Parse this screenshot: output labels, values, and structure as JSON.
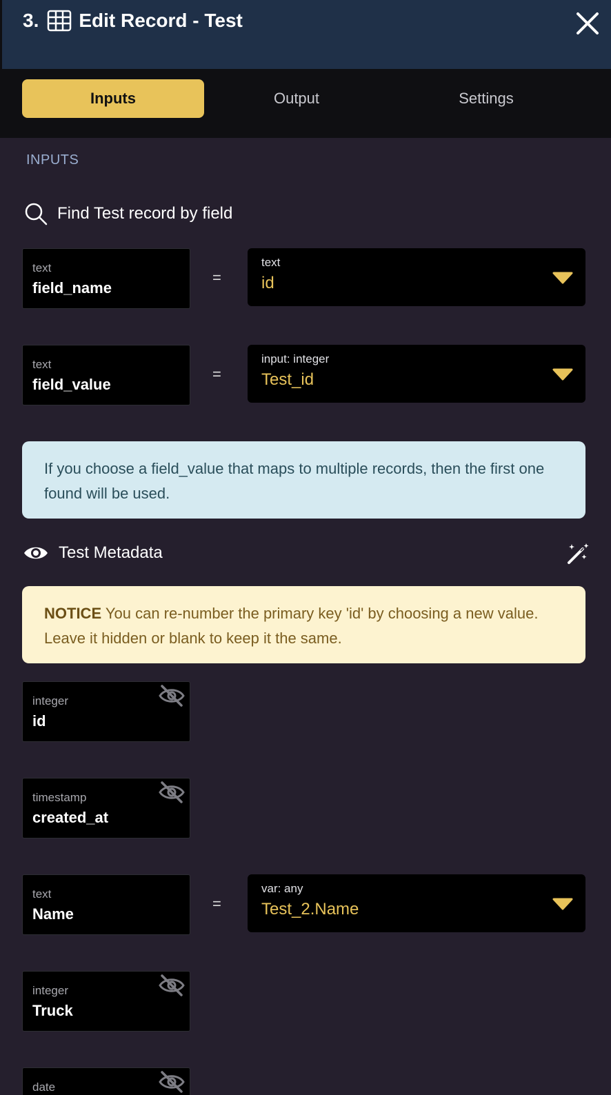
{
  "header": {
    "step": "3.",
    "title": "Edit Record - Test"
  },
  "tabs": [
    {
      "label": "Inputs",
      "active": true
    },
    {
      "label": "Output",
      "active": false
    },
    {
      "label": "Settings",
      "active": false
    }
  ],
  "section_label": "INPUTS",
  "find": {
    "title": "Find Test record by field",
    "rows": [
      {
        "type": "text",
        "name": "field_name",
        "operator": "=",
        "select_type": "text",
        "select_value": "id"
      },
      {
        "type": "text",
        "name": "field_value",
        "operator": "=",
        "select_type": "input: integer",
        "select_value": "Test_id"
      }
    ]
  },
  "info_text": "If you choose a field_value that maps to multiple records, then the first one found will be used.",
  "metadata": {
    "title": "Test Metadata"
  },
  "notice": {
    "label": "NOTICE",
    "text": " You can re-number the primary key 'id' by choosing a new value. Leave it hidden or blank to keep it the same."
  },
  "fields": [
    {
      "type": "integer",
      "name": "id"
    },
    {
      "type": "timestamp",
      "name": "created_at"
    },
    {
      "type": "text",
      "name": "Name",
      "operator": "=",
      "select_type": "var: any",
      "select_value": "Test_2.Name"
    },
    {
      "type": "integer",
      "name": "Truck"
    },
    {
      "type": "date",
      "name": ""
    }
  ],
  "colors": {
    "accent": "#e8c35a",
    "header_bg": "#1f3048",
    "body_bg": "#251f2d",
    "info_bg": "#d5eaf1",
    "notice_bg": "#fdf3d0"
  }
}
